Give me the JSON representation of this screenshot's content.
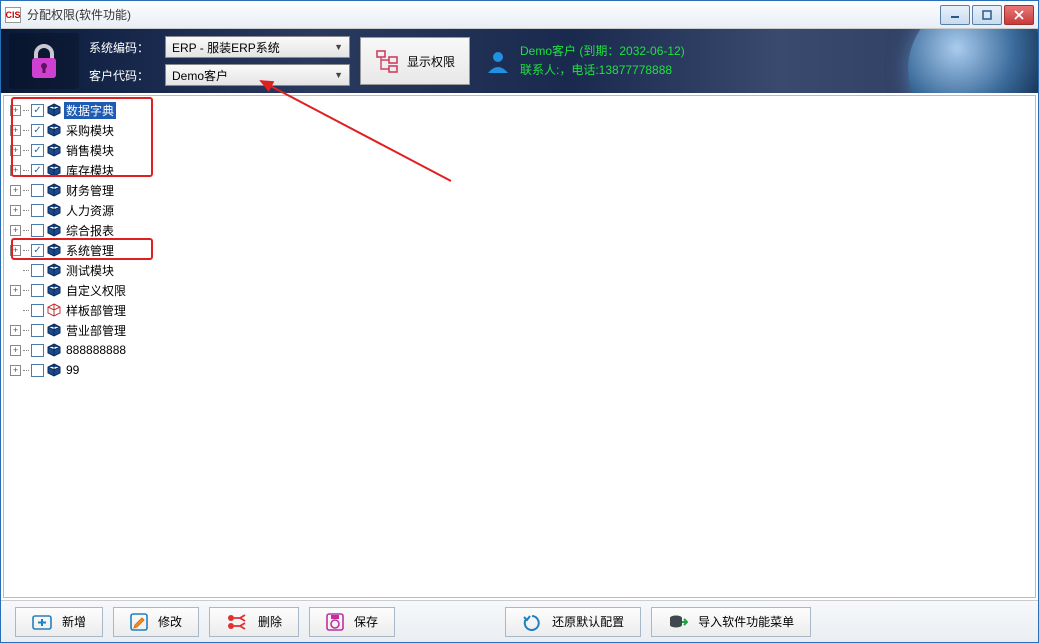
{
  "window": {
    "title": "分配权限(软件功能)",
    "app_icon": "CIS"
  },
  "header": {
    "sys_code_label": "系统编码：",
    "sys_code_value": "ERP - 服装ERP系统",
    "cust_code_label": "客户代码：",
    "cust_code_value": "Demo客户",
    "show_perm_label": "显示权限",
    "info_line1": "Demo客户 (到期：2032-06-12)",
    "info_line2": "联系人:，电话:13877778888"
  },
  "tree": [
    {
      "label": "数据字典",
      "checked": true,
      "expandable": true,
      "selected": true,
      "highlight": 1
    },
    {
      "label": "采购模块",
      "checked": true,
      "expandable": true,
      "highlight": 1
    },
    {
      "label": "销售模块",
      "checked": true,
      "expandable": true,
      "highlight": 1
    },
    {
      "label": "库存模块",
      "checked": true,
      "expandable": true,
      "highlight": 1
    },
    {
      "label": "财务管理",
      "checked": false,
      "expandable": true
    },
    {
      "label": "人力资源",
      "checked": false,
      "expandable": true
    },
    {
      "label": "综合报表",
      "checked": false,
      "expandable": true
    },
    {
      "label": "系统管理",
      "checked": true,
      "expandable": true,
      "highlight": 2
    },
    {
      "label": "测试模块",
      "checked": false,
      "expandable": false
    },
    {
      "label": "自定义权限",
      "checked": false,
      "expandable": true
    },
    {
      "label": "样板部管理",
      "checked": false,
      "expandable": false,
      "cube": "outline"
    },
    {
      "label": "营业部管理",
      "checked": false,
      "expandable": true
    },
    {
      "label": "888888888",
      "checked": false,
      "expandable": true
    },
    {
      "label": "99",
      "checked": false,
      "expandable": true
    }
  ],
  "footer": {
    "add": "新增",
    "edit": "修改",
    "delete": "删除",
    "save": "保存",
    "restore": "还原默认配置",
    "import": "导入软件功能菜单"
  }
}
